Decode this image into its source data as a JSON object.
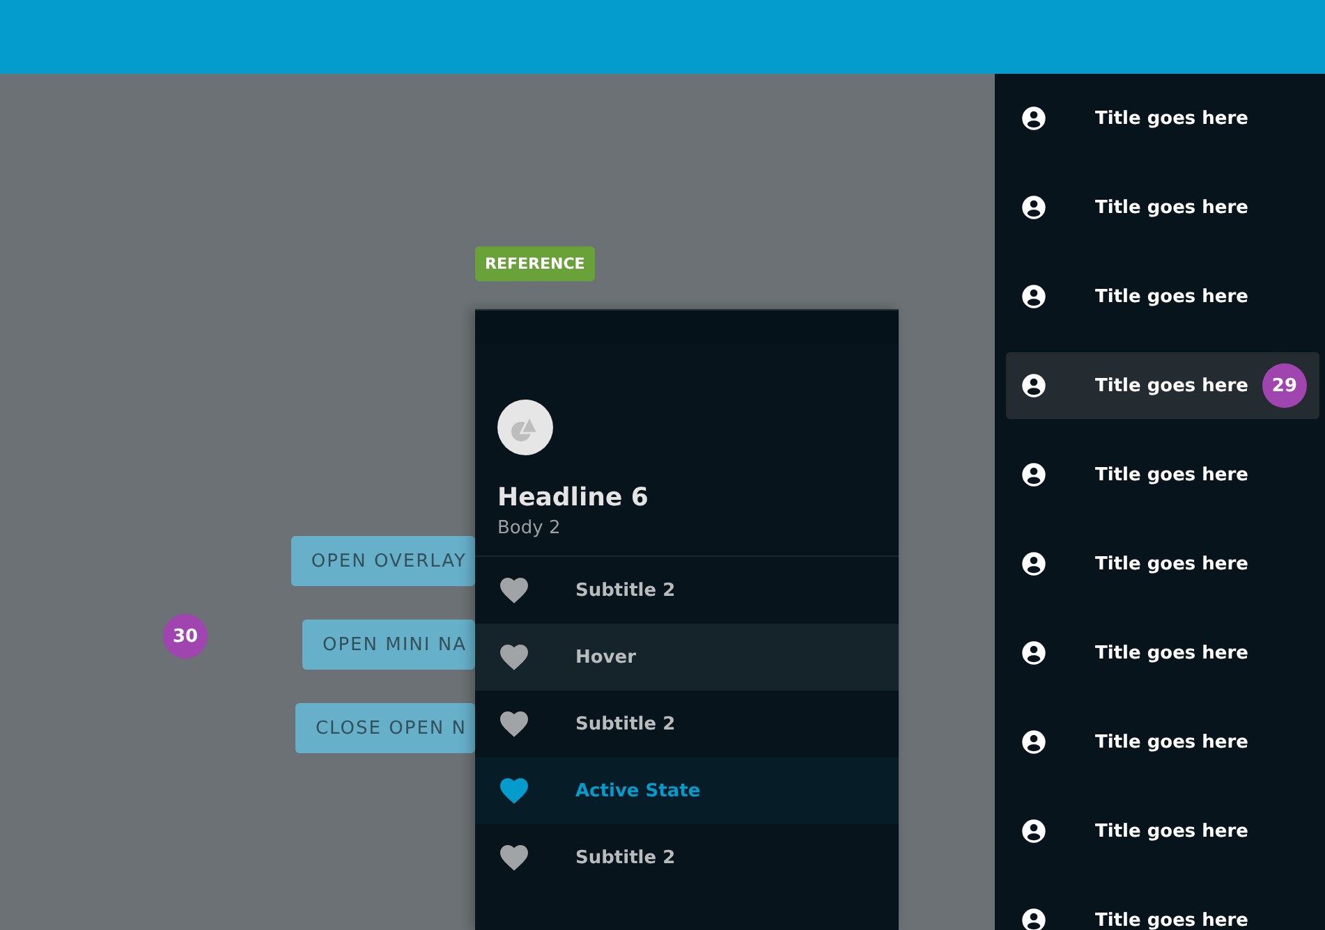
{
  "reference_tag": "REFERENCE",
  "buttons": [
    {
      "label": "OPEN OVERLAY"
    },
    {
      "label": "OPEN MINI NA"
    },
    {
      "label": "CLOSE OPEN N"
    }
  ],
  "step_badge": "30",
  "drawer": {
    "headline": "Headline 6",
    "body": "Body 2",
    "items": [
      {
        "label": "Subtitle 2",
        "selected": false,
        "hovered": false
      },
      {
        "label": "Hover",
        "selected": false,
        "hovered": true
      },
      {
        "label": "Subtitle 2",
        "selected": false,
        "hovered": false
      },
      {
        "label": "Active State",
        "selected": true,
        "hovered": false
      },
      {
        "label": "Subtitle 2",
        "selected": false,
        "hovered": false
      }
    ]
  },
  "sidebar": {
    "items": [
      {
        "title": "Title goes here",
        "selected": false
      },
      {
        "title": "Title goes here",
        "selected": false
      },
      {
        "title": "Title goes here",
        "selected": false
      },
      {
        "title": "Title goes here",
        "selected": true,
        "badge": "29"
      },
      {
        "title": "Title goes here",
        "selected": false
      },
      {
        "title": "Title goes here",
        "selected": false
      },
      {
        "title": "Title goes here",
        "selected": false
      },
      {
        "title": "Title goes here",
        "selected": false
      },
      {
        "title": "Title goes here",
        "selected": false
      },
      {
        "title": "Title goes here",
        "selected": false
      }
    ]
  }
}
